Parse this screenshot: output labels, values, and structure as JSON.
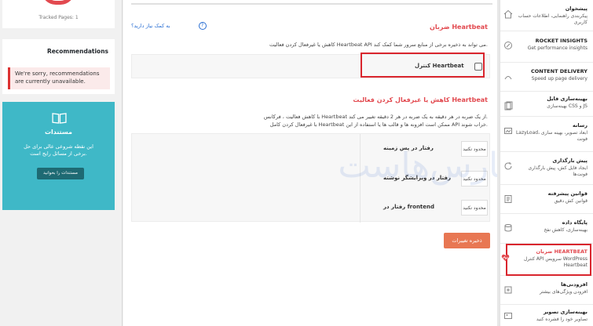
{
  "left": {
    "tracked_label": "Tracked Pages: 1",
    "recommendations_title": "Recommendations",
    "recommendations_alert": "We're sorry, recommendations are currently unavailable.",
    "docs_title": "مستندات",
    "docs_desc": "این نقطه شروعی عالی برای حل برخی از مسائل رایج است.",
    "docs_button": "مستندات را بخوانید"
  },
  "main": {
    "help_link": "به کمک نیاز دارید؟",
    "help_icon": "?",
    "heartbeat_title": "ضربان Heartbeat",
    "heartbeat_desc": "کاهش یا غیرفعال کردن فعالیت Heartbeat API می تواند به ذخیره برخی از منابع سرور شما کمک کند.",
    "heartbeat_control_label": "کنترل Heartbeat",
    "reduce_title": "کاهش یا غیرفعال کردن فعالیت Heartbeat",
    "reduce_desc_1": "با کاهش فعالیت ، فرکانس Heartbeat از یک ضربه در هر دقیقه به یک ضربه در هر 2 دقیقه تغییر می کند.",
    "reduce_desc_2": "با غیرفعال کردن کامل Heartbeat ممکن است افزونه ها و قالب ها یا استفاده از این API خراب شوند.",
    "options": [
      {
        "label": "رفتار در پس زمینه",
        "value": "محدود نکنید"
      },
      {
        "label": "رفتار در ویرایشگر نوشته",
        "value": "محدود نکنید"
      },
      {
        "label": "رفتار در frontend",
        "value": "محدود نکنید"
      }
    ],
    "save_button": "ذخیره تغییرات",
    "watermark": "پارس‌هاست"
  },
  "sidebar": {
    "items": [
      {
        "title": "پیشخوان",
        "sub": "پیکربندی راهنمایی، اطلاعات حساب کاربری",
        "icon": "home-icon"
      },
      {
        "title": "ROCKET INSIGHTS",
        "sub": "Get performance insights",
        "icon": "insights-icon"
      },
      {
        "title": "CONTENT DELIVERY",
        "sub": "Speed up page delivery",
        "icon": "delivery-icon"
      },
      {
        "title": "بهینه‌سازی فایل",
        "sub": "بهینه‌سازی CSS و JS",
        "icon": "file-icon"
      },
      {
        "title": "رسانه",
        "sub": "LazyLoad، ابعاد تصویر، بهینه سازی فونت",
        "icon": "media-icon"
      },
      {
        "title": "پیش بارگذاری",
        "sub": "ایجاد فایل کش، پیش بارگذاری فونت‌ها",
        "icon": "preload-icon"
      },
      {
        "title": "قوانین پیشرفته",
        "sub": "قوانین کش دقیق",
        "icon": "rules-icon"
      },
      {
        "title": "پایگاه داده",
        "sub": "بهینه‌سازی، کاهش نفخ",
        "icon": "database-icon"
      },
      {
        "title": "ضربان HEARTBEAT",
        "sub": "کنترل API سرویس WordPress Heartbeat",
        "icon": "heartbeat-icon"
      },
      {
        "title": "افزودنی‌ها",
        "sub": "افزودن ویژگی‌های بیشتر",
        "icon": "addons-icon"
      },
      {
        "title": "بهینه‌سازی تصویر",
        "sub": "تصاویر خود را فشرده کنید",
        "icon": "image-icon"
      }
    ]
  },
  "colors": {
    "accent": "#e2494f",
    "highlight_border": "#d9252d",
    "docs_bg": "#3fb8c7",
    "save_button": "#e87753"
  }
}
